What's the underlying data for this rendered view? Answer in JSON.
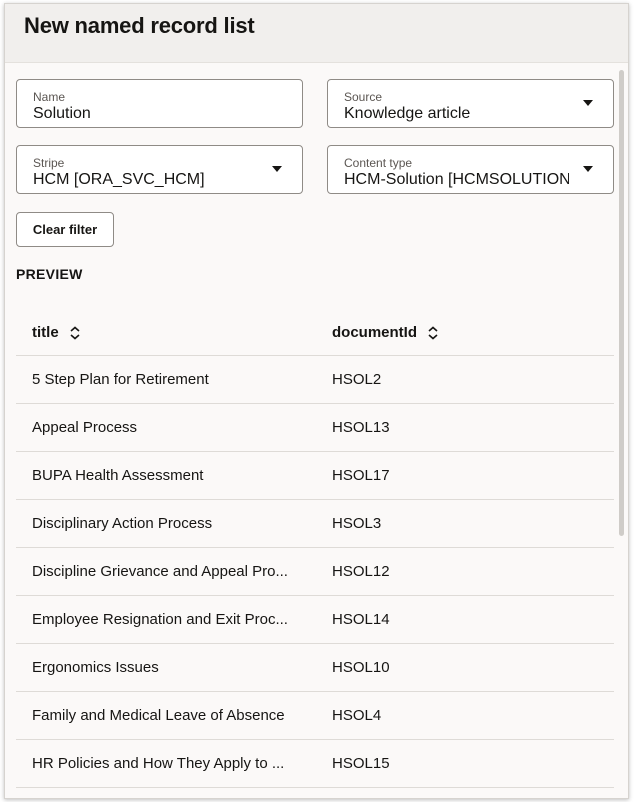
{
  "dialog": {
    "title": "New named record list"
  },
  "filters": {
    "name": {
      "label": "Name",
      "value": "Solution"
    },
    "source": {
      "label": "Source",
      "value": "Knowledge article"
    },
    "stripe": {
      "label": "Stripe",
      "value": "HCM [ORA_SVC_HCM]"
    },
    "content_type": {
      "label": "Content type",
      "value": "HCM-Solution [HCMSOLUTION"
    },
    "clear_label": "Clear filter"
  },
  "preview": {
    "label": "PREVIEW",
    "columns": [
      "title",
      "documentId"
    ],
    "rows": [
      [
        "5 Step Plan for Retirement",
        "HSOL2"
      ],
      [
        "Appeal Process",
        "HSOL13"
      ],
      [
        "BUPA Health Assessment",
        "HSOL17"
      ],
      [
        "Disciplinary Action Process",
        "HSOL3"
      ],
      [
        "Discipline Grievance and Appeal Pro...",
        "HSOL12"
      ],
      [
        "Employee Resignation and Exit Proc...",
        "HSOL14"
      ],
      [
        "Ergonomics Issues",
        "HSOL10"
      ],
      [
        "Family and Medical Leave of Absence",
        "HSOL4"
      ],
      [
        "HR Policies and How They Apply to ...",
        "HSOL15"
      ]
    ]
  },
  "icons": {
    "sort": "sort-icon",
    "dropdown": "chevron-down-icon"
  }
}
